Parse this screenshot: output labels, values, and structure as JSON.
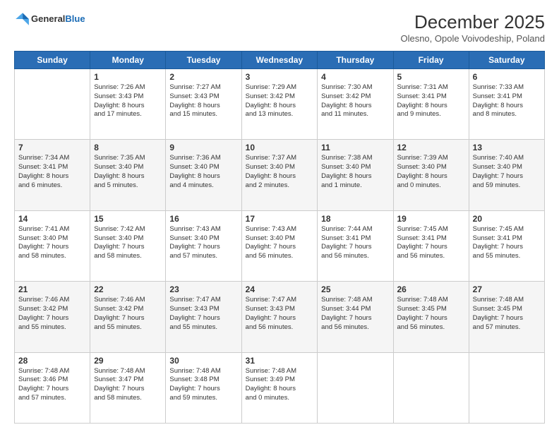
{
  "header": {
    "logo_line1": "General",
    "logo_line2": "Blue",
    "title": "December 2025",
    "subtitle": "Olesno, Opole Voivodeship, Poland"
  },
  "weekdays": [
    "Sunday",
    "Monday",
    "Tuesday",
    "Wednesday",
    "Thursday",
    "Friday",
    "Saturday"
  ],
  "weeks": [
    [
      {
        "day": "",
        "info": ""
      },
      {
        "day": "1",
        "info": "Sunrise: 7:26 AM\nSunset: 3:43 PM\nDaylight: 8 hours\nand 17 minutes."
      },
      {
        "day": "2",
        "info": "Sunrise: 7:27 AM\nSunset: 3:43 PM\nDaylight: 8 hours\nand 15 minutes."
      },
      {
        "day": "3",
        "info": "Sunrise: 7:29 AM\nSunset: 3:42 PM\nDaylight: 8 hours\nand 13 minutes."
      },
      {
        "day": "4",
        "info": "Sunrise: 7:30 AM\nSunset: 3:42 PM\nDaylight: 8 hours\nand 11 minutes."
      },
      {
        "day": "5",
        "info": "Sunrise: 7:31 AM\nSunset: 3:41 PM\nDaylight: 8 hours\nand 9 minutes."
      },
      {
        "day": "6",
        "info": "Sunrise: 7:33 AM\nSunset: 3:41 PM\nDaylight: 8 hours\nand 8 minutes."
      }
    ],
    [
      {
        "day": "7",
        "info": "Sunrise: 7:34 AM\nSunset: 3:41 PM\nDaylight: 8 hours\nand 6 minutes."
      },
      {
        "day": "8",
        "info": "Sunrise: 7:35 AM\nSunset: 3:40 PM\nDaylight: 8 hours\nand 5 minutes."
      },
      {
        "day": "9",
        "info": "Sunrise: 7:36 AM\nSunset: 3:40 PM\nDaylight: 8 hours\nand 4 minutes."
      },
      {
        "day": "10",
        "info": "Sunrise: 7:37 AM\nSunset: 3:40 PM\nDaylight: 8 hours\nand 2 minutes."
      },
      {
        "day": "11",
        "info": "Sunrise: 7:38 AM\nSunset: 3:40 PM\nDaylight: 8 hours\nand 1 minute."
      },
      {
        "day": "12",
        "info": "Sunrise: 7:39 AM\nSunset: 3:40 PM\nDaylight: 8 hours\nand 0 minutes."
      },
      {
        "day": "13",
        "info": "Sunrise: 7:40 AM\nSunset: 3:40 PM\nDaylight: 7 hours\nand 59 minutes."
      }
    ],
    [
      {
        "day": "14",
        "info": "Sunrise: 7:41 AM\nSunset: 3:40 PM\nDaylight: 7 hours\nand 58 minutes."
      },
      {
        "day": "15",
        "info": "Sunrise: 7:42 AM\nSunset: 3:40 PM\nDaylight: 7 hours\nand 58 minutes."
      },
      {
        "day": "16",
        "info": "Sunrise: 7:43 AM\nSunset: 3:40 PM\nDaylight: 7 hours\nand 57 minutes."
      },
      {
        "day": "17",
        "info": "Sunrise: 7:43 AM\nSunset: 3:40 PM\nDaylight: 7 hours\nand 56 minutes."
      },
      {
        "day": "18",
        "info": "Sunrise: 7:44 AM\nSunset: 3:41 PM\nDaylight: 7 hours\nand 56 minutes."
      },
      {
        "day": "19",
        "info": "Sunrise: 7:45 AM\nSunset: 3:41 PM\nDaylight: 7 hours\nand 56 minutes."
      },
      {
        "day": "20",
        "info": "Sunrise: 7:45 AM\nSunset: 3:41 PM\nDaylight: 7 hours\nand 55 minutes."
      }
    ],
    [
      {
        "day": "21",
        "info": "Sunrise: 7:46 AM\nSunset: 3:42 PM\nDaylight: 7 hours\nand 55 minutes."
      },
      {
        "day": "22",
        "info": "Sunrise: 7:46 AM\nSunset: 3:42 PM\nDaylight: 7 hours\nand 55 minutes."
      },
      {
        "day": "23",
        "info": "Sunrise: 7:47 AM\nSunset: 3:43 PM\nDaylight: 7 hours\nand 55 minutes."
      },
      {
        "day": "24",
        "info": "Sunrise: 7:47 AM\nSunset: 3:43 PM\nDaylight: 7 hours\nand 56 minutes."
      },
      {
        "day": "25",
        "info": "Sunrise: 7:48 AM\nSunset: 3:44 PM\nDaylight: 7 hours\nand 56 minutes."
      },
      {
        "day": "26",
        "info": "Sunrise: 7:48 AM\nSunset: 3:45 PM\nDaylight: 7 hours\nand 56 minutes."
      },
      {
        "day": "27",
        "info": "Sunrise: 7:48 AM\nSunset: 3:45 PM\nDaylight: 7 hours\nand 57 minutes."
      }
    ],
    [
      {
        "day": "28",
        "info": "Sunrise: 7:48 AM\nSunset: 3:46 PM\nDaylight: 7 hours\nand 57 minutes."
      },
      {
        "day": "29",
        "info": "Sunrise: 7:48 AM\nSunset: 3:47 PM\nDaylight: 7 hours\nand 58 minutes."
      },
      {
        "day": "30",
        "info": "Sunrise: 7:48 AM\nSunset: 3:48 PM\nDaylight: 7 hours\nand 59 minutes."
      },
      {
        "day": "31",
        "info": "Sunrise: 7:48 AM\nSunset: 3:49 PM\nDaylight: 8 hours\nand 0 minutes."
      },
      {
        "day": "",
        "info": ""
      },
      {
        "day": "",
        "info": ""
      },
      {
        "day": "",
        "info": ""
      }
    ]
  ]
}
